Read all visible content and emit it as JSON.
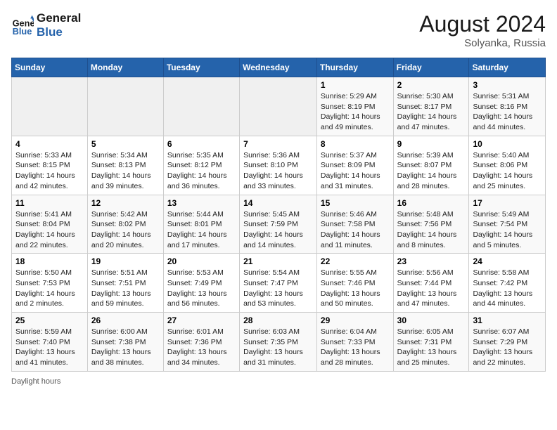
{
  "header": {
    "logo_line1": "General",
    "logo_line2": "Blue",
    "month_year": "August 2024",
    "location": "Solyanka, Russia"
  },
  "days_of_week": [
    "Sunday",
    "Monday",
    "Tuesday",
    "Wednesday",
    "Thursday",
    "Friday",
    "Saturday"
  ],
  "footer": {
    "note": "Daylight hours"
  },
  "weeks": [
    {
      "days": [
        {
          "num": "",
          "info": ""
        },
        {
          "num": "",
          "info": ""
        },
        {
          "num": "",
          "info": ""
        },
        {
          "num": "",
          "info": ""
        },
        {
          "num": "1",
          "info": "Sunrise: 5:29 AM\nSunset: 8:19 PM\nDaylight: 14 hours\nand 49 minutes."
        },
        {
          "num": "2",
          "info": "Sunrise: 5:30 AM\nSunset: 8:17 PM\nDaylight: 14 hours\nand 47 minutes."
        },
        {
          "num": "3",
          "info": "Sunrise: 5:31 AM\nSunset: 8:16 PM\nDaylight: 14 hours\nand 44 minutes."
        }
      ]
    },
    {
      "days": [
        {
          "num": "4",
          "info": "Sunrise: 5:33 AM\nSunset: 8:15 PM\nDaylight: 14 hours\nand 42 minutes."
        },
        {
          "num": "5",
          "info": "Sunrise: 5:34 AM\nSunset: 8:13 PM\nDaylight: 14 hours\nand 39 minutes."
        },
        {
          "num": "6",
          "info": "Sunrise: 5:35 AM\nSunset: 8:12 PM\nDaylight: 14 hours\nand 36 minutes."
        },
        {
          "num": "7",
          "info": "Sunrise: 5:36 AM\nSunset: 8:10 PM\nDaylight: 14 hours\nand 33 minutes."
        },
        {
          "num": "8",
          "info": "Sunrise: 5:37 AM\nSunset: 8:09 PM\nDaylight: 14 hours\nand 31 minutes."
        },
        {
          "num": "9",
          "info": "Sunrise: 5:39 AM\nSunset: 8:07 PM\nDaylight: 14 hours\nand 28 minutes."
        },
        {
          "num": "10",
          "info": "Sunrise: 5:40 AM\nSunset: 8:06 PM\nDaylight: 14 hours\nand 25 minutes."
        }
      ]
    },
    {
      "days": [
        {
          "num": "11",
          "info": "Sunrise: 5:41 AM\nSunset: 8:04 PM\nDaylight: 14 hours\nand 22 minutes."
        },
        {
          "num": "12",
          "info": "Sunrise: 5:42 AM\nSunset: 8:02 PM\nDaylight: 14 hours\nand 20 minutes."
        },
        {
          "num": "13",
          "info": "Sunrise: 5:44 AM\nSunset: 8:01 PM\nDaylight: 14 hours\nand 17 minutes."
        },
        {
          "num": "14",
          "info": "Sunrise: 5:45 AM\nSunset: 7:59 PM\nDaylight: 14 hours\nand 14 minutes."
        },
        {
          "num": "15",
          "info": "Sunrise: 5:46 AM\nSunset: 7:58 PM\nDaylight: 14 hours\nand 11 minutes."
        },
        {
          "num": "16",
          "info": "Sunrise: 5:48 AM\nSunset: 7:56 PM\nDaylight: 14 hours\nand 8 minutes."
        },
        {
          "num": "17",
          "info": "Sunrise: 5:49 AM\nSunset: 7:54 PM\nDaylight: 14 hours\nand 5 minutes."
        }
      ]
    },
    {
      "days": [
        {
          "num": "18",
          "info": "Sunrise: 5:50 AM\nSunset: 7:53 PM\nDaylight: 14 hours\nand 2 minutes."
        },
        {
          "num": "19",
          "info": "Sunrise: 5:51 AM\nSunset: 7:51 PM\nDaylight: 13 hours\nand 59 minutes."
        },
        {
          "num": "20",
          "info": "Sunrise: 5:53 AM\nSunset: 7:49 PM\nDaylight: 13 hours\nand 56 minutes."
        },
        {
          "num": "21",
          "info": "Sunrise: 5:54 AM\nSunset: 7:47 PM\nDaylight: 13 hours\nand 53 minutes."
        },
        {
          "num": "22",
          "info": "Sunrise: 5:55 AM\nSunset: 7:46 PM\nDaylight: 13 hours\nand 50 minutes."
        },
        {
          "num": "23",
          "info": "Sunrise: 5:56 AM\nSunset: 7:44 PM\nDaylight: 13 hours\nand 47 minutes."
        },
        {
          "num": "24",
          "info": "Sunrise: 5:58 AM\nSunset: 7:42 PM\nDaylight: 13 hours\nand 44 minutes."
        }
      ]
    },
    {
      "days": [
        {
          "num": "25",
          "info": "Sunrise: 5:59 AM\nSunset: 7:40 PM\nDaylight: 13 hours\nand 41 minutes."
        },
        {
          "num": "26",
          "info": "Sunrise: 6:00 AM\nSunset: 7:38 PM\nDaylight: 13 hours\nand 38 minutes."
        },
        {
          "num": "27",
          "info": "Sunrise: 6:01 AM\nSunset: 7:36 PM\nDaylight: 13 hours\nand 34 minutes."
        },
        {
          "num": "28",
          "info": "Sunrise: 6:03 AM\nSunset: 7:35 PM\nDaylight: 13 hours\nand 31 minutes."
        },
        {
          "num": "29",
          "info": "Sunrise: 6:04 AM\nSunset: 7:33 PM\nDaylight: 13 hours\nand 28 minutes."
        },
        {
          "num": "30",
          "info": "Sunrise: 6:05 AM\nSunset: 7:31 PM\nDaylight: 13 hours\nand 25 minutes."
        },
        {
          "num": "31",
          "info": "Sunrise: 6:07 AM\nSunset: 7:29 PM\nDaylight: 13 hours\nand 22 minutes."
        }
      ]
    }
  ]
}
